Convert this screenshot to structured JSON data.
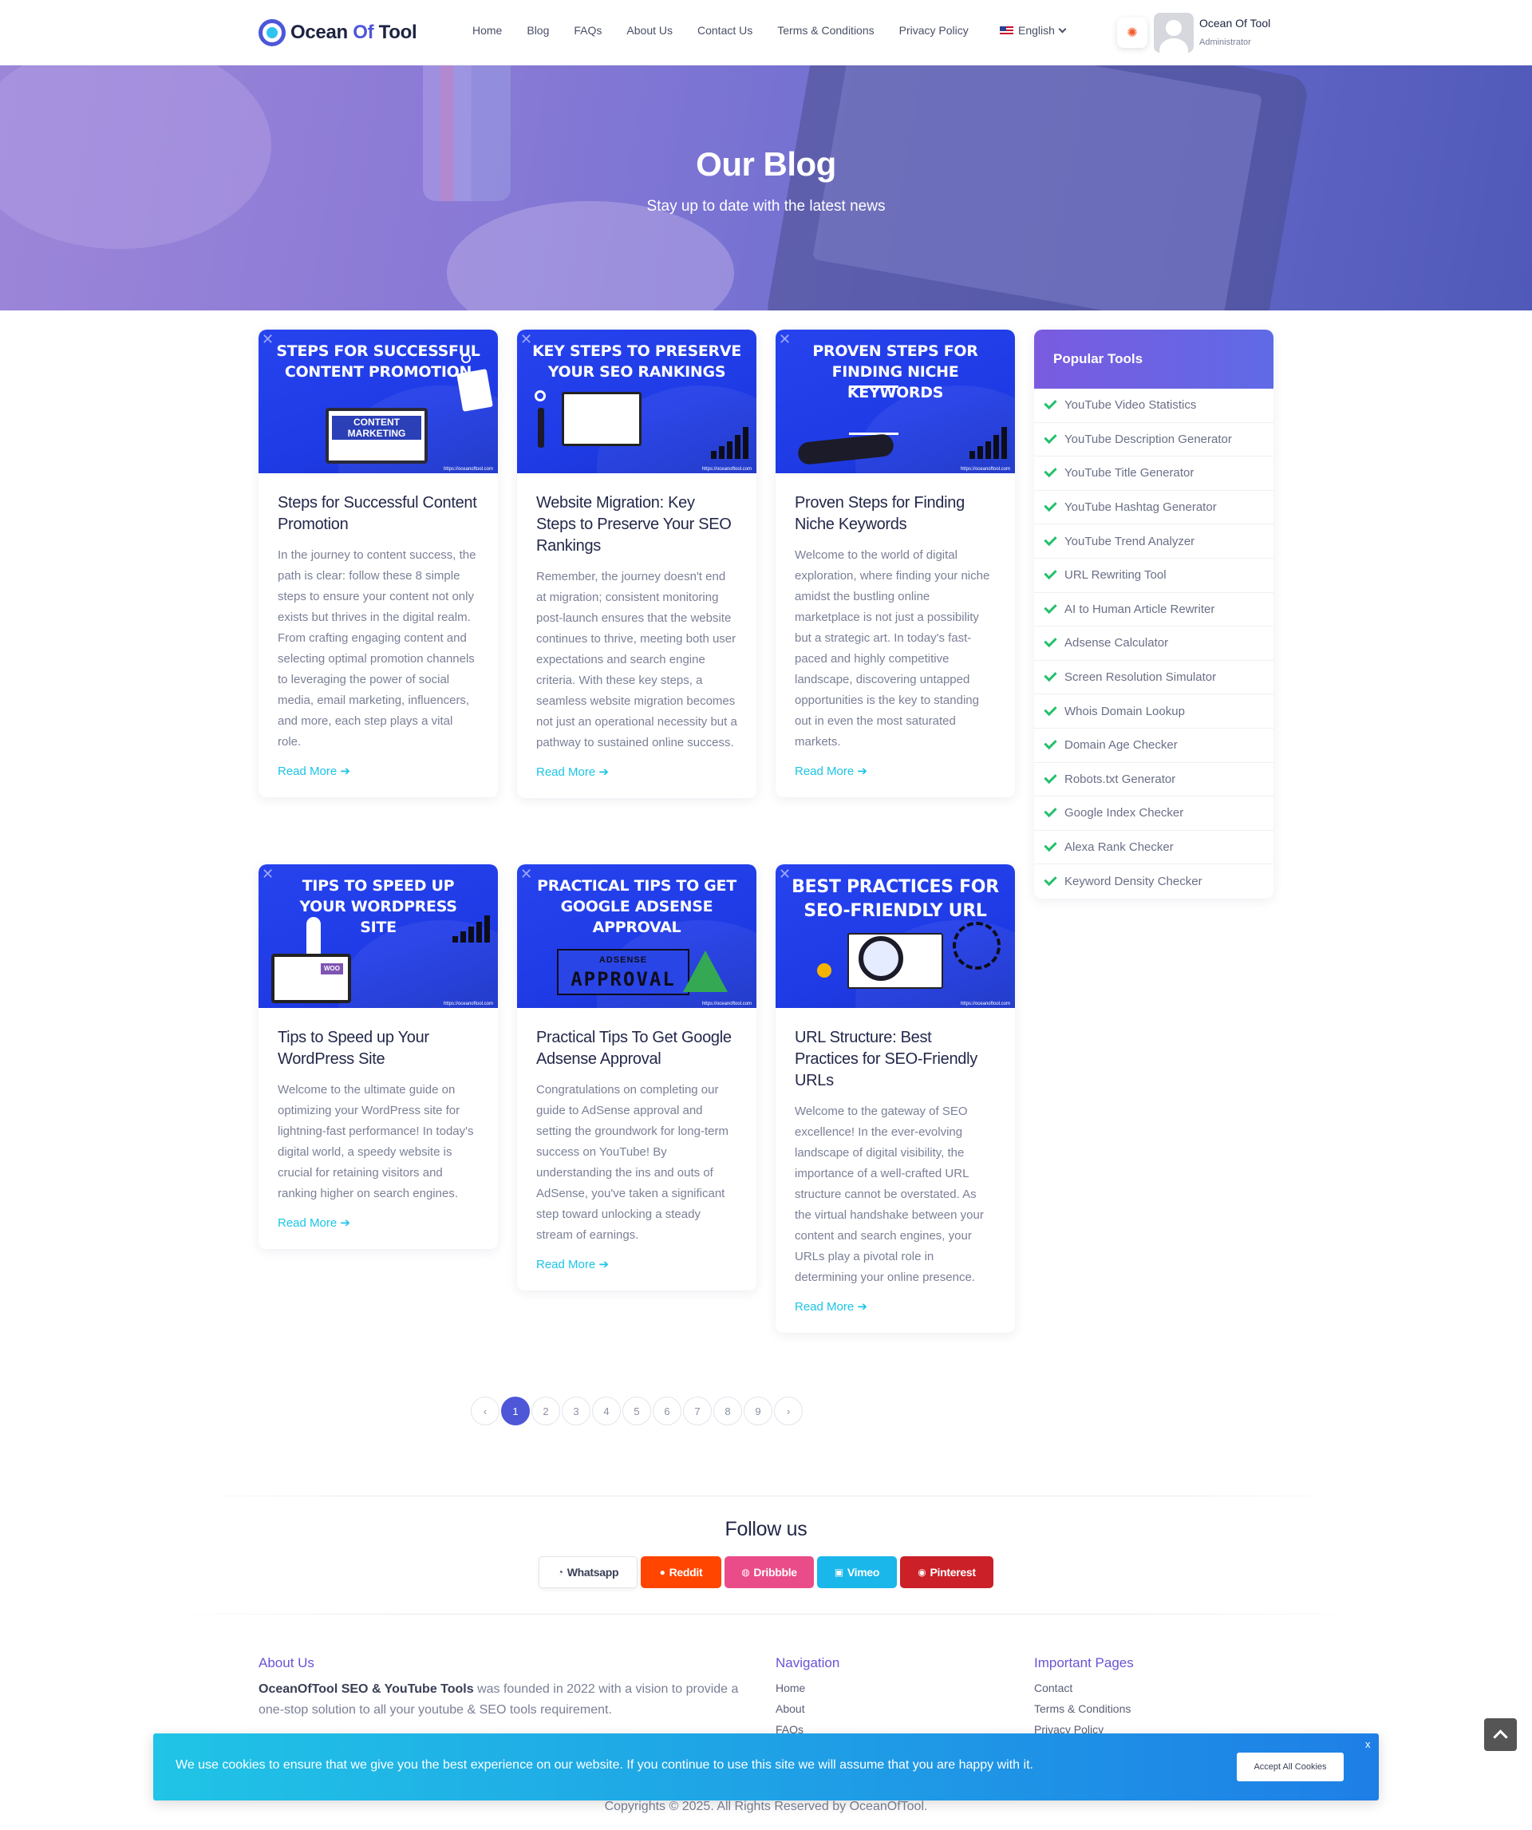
{
  "header": {
    "logo_part1": "Ocean ",
    "logo_part2": "Of",
    "logo_part3": " Tool",
    "nav": [
      "Home",
      "Blog",
      "FAQs",
      "About Us",
      "Contact Us",
      "Terms & Conditions",
      "Privacy Policy"
    ],
    "language": "English",
    "user_name": "Ocean Of Tool",
    "user_role": "Administrator"
  },
  "hero": {
    "title": "Our Blog",
    "subtitle": "Stay up to date with the latest news"
  },
  "posts": [
    {
      "image_title": "Steps for Successful Content Promotion",
      "title": "Steps for Successful Content Promotion",
      "excerpt": "In the journey to content success, the path is clear: follow these 8 simple steps to ensure your content not only exists but thrives in the digital realm. From crafting engaging content and selecting optimal promotion channels to leveraging the power of social media, email marketing, influencers, and more, each step plays a vital role.",
      "read_more": "Read More",
      "image_badge": "CONTENT MARKETING"
    },
    {
      "image_title": "Key Steps to Preserve Your SEO Rankings",
      "title": "Website Migration: Key Steps to Preserve Your SEO Rankings",
      "excerpt": " Remember, the journey doesn't end at migration; consistent monitoring post-launch ensures that the website continues to thrive, meeting both user expectations and search engine criteria. With these key steps, a seamless website migration becomes not just an operational necessity but a pathway to sustained online success.",
      "read_more": "Read More"
    },
    {
      "image_title": "Proven Steps for Finding Niche Keywords",
      "title": "Proven Steps for Finding Niche Keywords",
      "excerpt": "Welcome to the world of digital exploration, where finding your niche amidst the bustling online marketplace is not just a possibility but a strategic art. In today's fast-paced and highly competitive landscape, discovering untapped opportunities is the key to standing out in even the most saturated markets.",
      "read_more": "Read More"
    },
    {
      "image_title": "Tips to Speed up Your WordPress Site",
      "title": "Tips to Speed up Your WordPress Site",
      "excerpt": "Welcome to the ultimate guide on optimizing your WordPress site for lightning-fast performance! In today's digital world, a speedy website is crucial for retaining visitors and ranking higher on search engines.",
      "read_more": "Read More",
      "image_badge": "WOO"
    },
    {
      "image_title": "Practical Tips to Get Google Adsense Approval",
      "title": "Practical Tips To Get Google Adsense Approval",
      "excerpt": "Congratulations on completing our guide to AdSense approval and setting the groundwork for long-term success on YouTube! By understanding the ins and outs of AdSense, you've taken a significant step toward unlocking a steady stream of earnings.",
      "read_more": "Read More",
      "image_badge_small": "ADSENSE",
      "image_badge": "APPROVAL"
    },
    {
      "image_title": "Best Practices for SEO-Friendly URL",
      "title": "URL Structure: Best Practices for SEO-Friendly URLs",
      "excerpt": "Welcome to the gateway of SEO excellence! In the ever-evolving landscape of digital visibility, the importance of a well-crafted URL structure cannot be overstated. As the virtual handshake between your content and search engines, your URLs play a pivotal role in determining your online presence.",
      "read_more": "Read More"
    }
  ],
  "image_watermark": "https://oceanoftool.com",
  "sidebar": {
    "title": "Popular Tools",
    "tools": [
      "YouTube Video Statistics",
      "YouTube Description Generator",
      "YouTube Title Generator",
      "YouTube Hashtag Generator",
      "YouTube Trend Analyzer",
      "URL Rewriting Tool",
      "AI to Human Article Rewriter",
      "Adsense Calculator",
      "Screen Resolution Simulator",
      "Whois Domain Lookup",
      "Domain Age Checker",
      "Robots.txt Generator",
      "Google Index Checker",
      "Alexa Rank Checker",
      "Keyword Density Checker"
    ]
  },
  "pagination": {
    "prev": "‹",
    "next": "›",
    "pages": [
      "1",
      "2",
      "3",
      "4",
      "5",
      "6",
      "7",
      "8",
      "9"
    ],
    "active": "1"
  },
  "follow": {
    "title": "Follow us",
    "buttons": [
      {
        "label": "Whatsapp",
        "icon": "whatsapp-icon",
        "color": "#ffffff"
      },
      {
        "label": "Reddit",
        "icon": "reddit-icon",
        "color": "#ff4500"
      },
      {
        "label": "Dribbble",
        "icon": "dribbble-icon",
        "color": "#ea4c89"
      },
      {
        "label": "Vimeo",
        "icon": "vimeo-icon",
        "color": "#1ab7ea"
      },
      {
        "label": "Pinterest",
        "icon": "pinterest-icon",
        "color": "#cb2027"
      }
    ]
  },
  "footer": {
    "about_title": "About Us",
    "about_brand": "OceanOfTool SEO & YouTube Tools",
    "about_text": " was founded in 2022 with a vision to provide a one-stop solution to all your youtube & SEO tools requirement.",
    "nav_title": "Navigation",
    "nav_links": [
      "Home",
      "About",
      "FAQs"
    ],
    "pages_title": "Important Pages",
    "pages_links": [
      "Contact",
      "Terms & Conditions",
      "Privacy Policy"
    ],
    "copyright": "Copyrights © 2025. All Rights Reserved by OceanOfTool."
  },
  "cookie": {
    "text": "We use cookies to ensure that we give you the best experience on our website. If you continue to use this site we will assume that you are happy with it.",
    "accept": "Accept All Cookies",
    "close": "x"
  },
  "colors": {
    "accent": "#4d57d8",
    "link": "#1cc4e6",
    "check": "#23c06b",
    "thumb_blue": "#2743ee"
  }
}
